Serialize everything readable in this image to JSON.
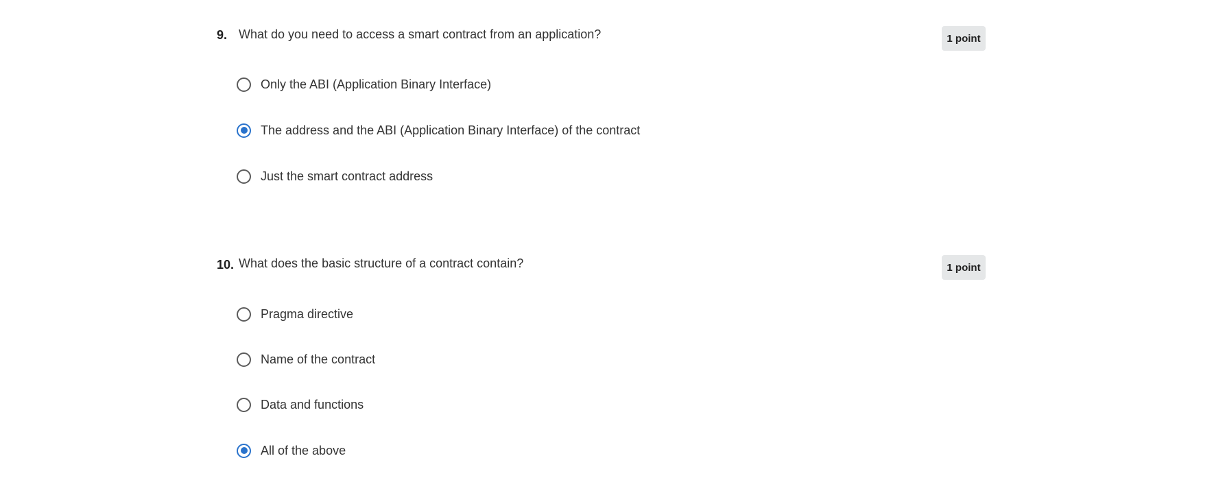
{
  "questions": [
    {
      "number": "9.",
      "text": "What do you need to access a smart contract from an application?",
      "points": "1 point",
      "options": [
        {
          "label": "Only the ABI (Application Binary Interface)",
          "selected": false
        },
        {
          "label": "The address and the ABI (Application Binary Interface) of the contract",
          "selected": true
        },
        {
          "label": "Just the smart contract address",
          "selected": false
        }
      ]
    },
    {
      "number": "10.",
      "text": "What does the basic structure of a contract contain?",
      "points": "1 point",
      "options": [
        {
          "label": "Pragma directive",
          "selected": false
        },
        {
          "label": "Name of the contract",
          "selected": false
        },
        {
          "label": "Data and functions",
          "selected": false
        },
        {
          "label": "All of the above",
          "selected": true
        }
      ]
    }
  ],
  "colors": {
    "accent": "#2a73cc",
    "radio_border": "#5b5b5b",
    "badge_bg": "#e5e7e8",
    "text": "#333333"
  }
}
